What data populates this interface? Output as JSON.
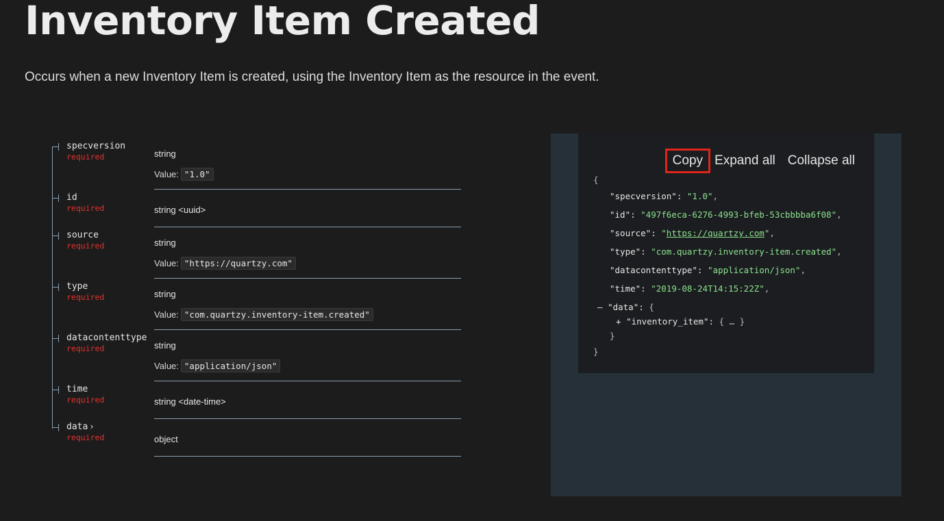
{
  "title": "Inventory Item Created",
  "description": "Occurs when a new Inventory Item is created, using the Inventory Item as the resource in the event.",
  "required_label": "required",
  "value_label": "Value:",
  "properties": [
    {
      "name": "specversion",
      "type": "string",
      "value": "\"1.0\""
    },
    {
      "name": "id",
      "type": "string <uuid>",
      "value": null
    },
    {
      "name": "source",
      "type": "string",
      "value": "\"https://quartzy.com\""
    },
    {
      "name": "type",
      "type": "string",
      "value": "\"com.quartzy.inventory-item.created\""
    },
    {
      "name": "datacontenttype",
      "type": "string",
      "value": "\"application/json\""
    },
    {
      "name": "time",
      "type": "string <date-time>",
      "value": null
    },
    {
      "name": "data",
      "type": "object",
      "value": null,
      "expandable": true
    }
  ],
  "panel": {
    "copy_label": "Copy",
    "expand_label": "Expand all",
    "collapse_label": "Collapse all",
    "json": {
      "specversion": "\"1.0\"",
      "id": "\"497f6eca-6276-4993-bfeb-53cbbbba6f08\"",
      "source": "https://quartzy.com",
      "type": "\"com.quartzy.inventory-item.created\"",
      "datacontenttype": "\"application/json\"",
      "time": "\"2019-08-24T14:15:22Z\"",
      "data_key": "\"data\"",
      "inventory_item_key": "\"inventory_item\"",
      "collapsed": "{ … }"
    }
  }
}
